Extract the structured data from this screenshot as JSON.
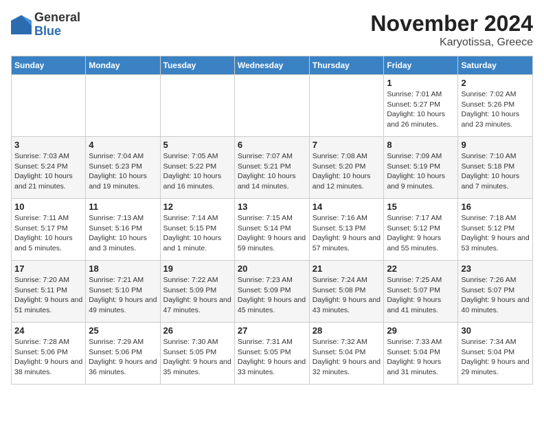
{
  "logo": {
    "general": "General",
    "blue": "Blue"
  },
  "title": "November 2024",
  "subtitle": "Karyotissa, Greece",
  "weekdays": [
    "Sunday",
    "Monday",
    "Tuesday",
    "Wednesday",
    "Thursday",
    "Friday",
    "Saturday"
  ],
  "weeks": [
    [
      {
        "day": "",
        "info": ""
      },
      {
        "day": "",
        "info": ""
      },
      {
        "day": "",
        "info": ""
      },
      {
        "day": "",
        "info": ""
      },
      {
        "day": "",
        "info": ""
      },
      {
        "day": "1",
        "info": "Sunrise: 7:01 AM\nSunset: 5:27 PM\nDaylight: 10 hours and 26 minutes."
      },
      {
        "day": "2",
        "info": "Sunrise: 7:02 AM\nSunset: 5:26 PM\nDaylight: 10 hours and 23 minutes."
      }
    ],
    [
      {
        "day": "3",
        "info": "Sunrise: 7:03 AM\nSunset: 5:24 PM\nDaylight: 10 hours and 21 minutes."
      },
      {
        "day": "4",
        "info": "Sunrise: 7:04 AM\nSunset: 5:23 PM\nDaylight: 10 hours and 19 minutes."
      },
      {
        "day": "5",
        "info": "Sunrise: 7:05 AM\nSunset: 5:22 PM\nDaylight: 10 hours and 16 minutes."
      },
      {
        "day": "6",
        "info": "Sunrise: 7:07 AM\nSunset: 5:21 PM\nDaylight: 10 hours and 14 minutes."
      },
      {
        "day": "7",
        "info": "Sunrise: 7:08 AM\nSunset: 5:20 PM\nDaylight: 10 hours and 12 minutes."
      },
      {
        "day": "8",
        "info": "Sunrise: 7:09 AM\nSunset: 5:19 PM\nDaylight: 10 hours and 9 minutes."
      },
      {
        "day": "9",
        "info": "Sunrise: 7:10 AM\nSunset: 5:18 PM\nDaylight: 10 hours and 7 minutes."
      }
    ],
    [
      {
        "day": "10",
        "info": "Sunrise: 7:11 AM\nSunset: 5:17 PM\nDaylight: 10 hours and 5 minutes."
      },
      {
        "day": "11",
        "info": "Sunrise: 7:13 AM\nSunset: 5:16 PM\nDaylight: 10 hours and 3 minutes."
      },
      {
        "day": "12",
        "info": "Sunrise: 7:14 AM\nSunset: 5:15 PM\nDaylight: 10 hours and 1 minute."
      },
      {
        "day": "13",
        "info": "Sunrise: 7:15 AM\nSunset: 5:14 PM\nDaylight: 9 hours and 59 minutes."
      },
      {
        "day": "14",
        "info": "Sunrise: 7:16 AM\nSunset: 5:13 PM\nDaylight: 9 hours and 57 minutes."
      },
      {
        "day": "15",
        "info": "Sunrise: 7:17 AM\nSunset: 5:12 PM\nDaylight: 9 hours and 55 minutes."
      },
      {
        "day": "16",
        "info": "Sunrise: 7:18 AM\nSunset: 5:12 PM\nDaylight: 9 hours and 53 minutes."
      }
    ],
    [
      {
        "day": "17",
        "info": "Sunrise: 7:20 AM\nSunset: 5:11 PM\nDaylight: 9 hours and 51 minutes."
      },
      {
        "day": "18",
        "info": "Sunrise: 7:21 AM\nSunset: 5:10 PM\nDaylight: 9 hours and 49 minutes."
      },
      {
        "day": "19",
        "info": "Sunrise: 7:22 AM\nSunset: 5:09 PM\nDaylight: 9 hours and 47 minutes."
      },
      {
        "day": "20",
        "info": "Sunrise: 7:23 AM\nSunset: 5:09 PM\nDaylight: 9 hours and 45 minutes."
      },
      {
        "day": "21",
        "info": "Sunrise: 7:24 AM\nSunset: 5:08 PM\nDaylight: 9 hours and 43 minutes."
      },
      {
        "day": "22",
        "info": "Sunrise: 7:25 AM\nSunset: 5:07 PM\nDaylight: 9 hours and 41 minutes."
      },
      {
        "day": "23",
        "info": "Sunrise: 7:26 AM\nSunset: 5:07 PM\nDaylight: 9 hours and 40 minutes."
      }
    ],
    [
      {
        "day": "24",
        "info": "Sunrise: 7:28 AM\nSunset: 5:06 PM\nDaylight: 9 hours and 38 minutes."
      },
      {
        "day": "25",
        "info": "Sunrise: 7:29 AM\nSunset: 5:06 PM\nDaylight: 9 hours and 36 minutes."
      },
      {
        "day": "26",
        "info": "Sunrise: 7:30 AM\nSunset: 5:05 PM\nDaylight: 9 hours and 35 minutes."
      },
      {
        "day": "27",
        "info": "Sunrise: 7:31 AM\nSunset: 5:05 PM\nDaylight: 9 hours and 33 minutes."
      },
      {
        "day": "28",
        "info": "Sunrise: 7:32 AM\nSunset: 5:04 PM\nDaylight: 9 hours and 32 minutes."
      },
      {
        "day": "29",
        "info": "Sunrise: 7:33 AM\nSunset: 5:04 PM\nDaylight: 9 hours and 31 minutes."
      },
      {
        "day": "30",
        "info": "Sunrise: 7:34 AM\nSunset: 5:04 PM\nDaylight: 9 hours and 29 minutes."
      }
    ]
  ]
}
